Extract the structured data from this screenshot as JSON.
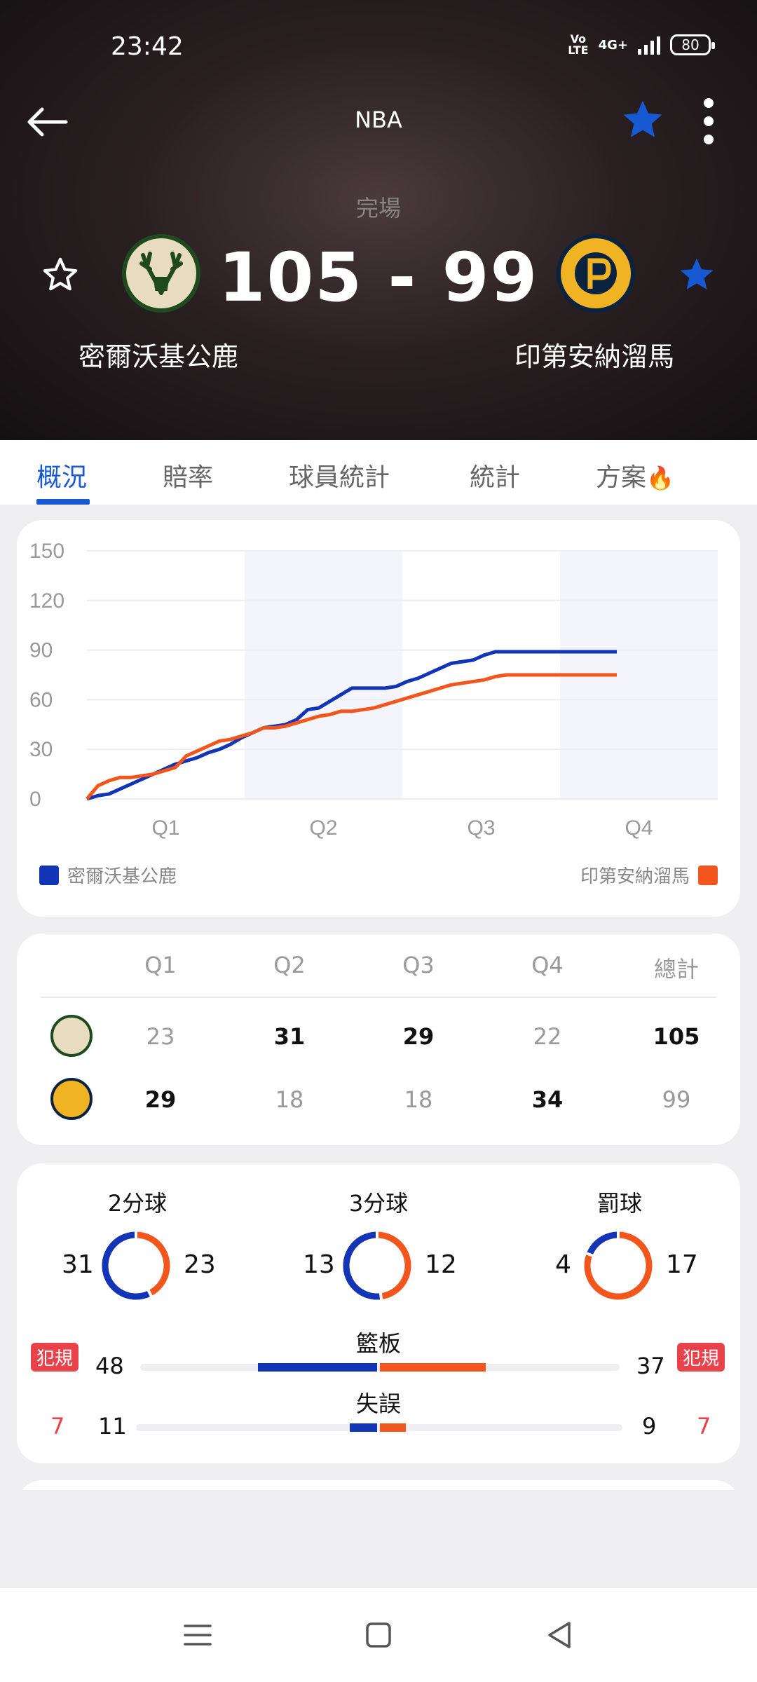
{
  "status_bar": {
    "time": "23:42",
    "volte": "Vo\nLTE",
    "network": "4G+",
    "battery": "80"
  },
  "header": {
    "title": "NBA",
    "status": "完場",
    "score": "105 - 99",
    "home": {
      "name": "密爾沃基公鹿",
      "logo": "bucks-logo"
    },
    "away": {
      "name": "印第安納溜馬",
      "logo": "pacers-logo"
    }
  },
  "colors": {
    "home": "#1235b8",
    "away": "#f2561d",
    "accent": "#1759d3",
    "foul": "#e8434a"
  },
  "tabs": [
    {
      "label": "概況",
      "active": true
    },
    {
      "label": "賠率"
    },
    {
      "label": "球員統計"
    },
    {
      "label": "統計"
    },
    {
      "label": "方案"
    }
  ],
  "chart_data": {
    "type": "line",
    "y_ticks": [
      "150",
      "120",
      "90",
      "60",
      "30",
      "0"
    ],
    "ylim": [
      0,
      150
    ],
    "x_ticks": [
      "Q1",
      "Q2",
      "Q3",
      "Q4"
    ],
    "xlim": [
      0,
      48
    ],
    "grid": true,
    "legend": "bottom",
    "series": [
      {
        "name": "密爾沃基公鹿",
        "color": "#1235b8",
        "x": [
          0,
          1,
          2,
          3,
          4,
          5,
          6,
          7,
          8,
          9,
          10,
          11,
          12,
          13,
          14,
          15,
          16,
          17,
          18,
          19,
          20,
          21,
          22,
          23,
          24,
          25,
          26,
          27,
          28,
          29,
          30,
          31,
          32,
          33,
          34,
          35,
          36,
          37,
          38,
          39,
          40,
          41,
          42,
          43,
          44,
          45,
          46,
          47,
          48
        ],
        "y": [
          0,
          2,
          3,
          6,
          9,
          12,
          15,
          18,
          21,
          23,
          25,
          28,
          30,
          33,
          37,
          40,
          43,
          44,
          45,
          48,
          54,
          55,
          59,
          63,
          67,
          67,
          67,
          67,
          68,
          71,
          73,
          76,
          79,
          82,
          83,
          84,
          87,
          89,
          89,
          89,
          89,
          89,
          89,
          89,
          89,
          89,
          89,
          89,
          89
        ]
      },
      {
        "name": "印第安納溜馬",
        "color": "#f2561d",
        "x": [
          0,
          1,
          2,
          3,
          4,
          5,
          6,
          7,
          8,
          9,
          10,
          11,
          12,
          13,
          14,
          15,
          16,
          17,
          18,
          19,
          20,
          21,
          22,
          23,
          24,
          25,
          26,
          27,
          28,
          29,
          30,
          31,
          32,
          33,
          34,
          35,
          36,
          37,
          38,
          39,
          40,
          41,
          42,
          43,
          44,
          45,
          46,
          47,
          48
        ],
        "y": [
          0,
          8,
          11,
          13,
          13,
          14,
          15,
          17,
          19,
          26,
          29,
          32,
          35,
          36,
          38,
          40,
          43,
          43,
          44,
          46,
          48,
          50,
          51,
          53,
          53,
          54,
          55,
          57,
          59,
          61,
          63,
          65,
          67,
          69,
          70,
          71,
          72,
          74,
          75,
          75,
          75,
          75,
          75,
          75,
          75,
          75,
          75,
          75,
          75
        ]
      }
    ]
  },
  "quarters": {
    "headers": [
      "Q1",
      "Q2",
      "Q3",
      "Q4",
      "總計"
    ],
    "home": [
      "23",
      "31",
      "29",
      "22",
      "105"
    ],
    "away": [
      "29",
      "18",
      "18",
      "34",
      "99"
    ]
  },
  "shots": [
    {
      "label": "2分球",
      "home": "31",
      "away": "23",
      "home_value": 31,
      "away_value": 23
    },
    {
      "label": "3分球",
      "home": "13",
      "away": "12",
      "home_value": 13,
      "away_value": 12
    },
    {
      "label": "罰球",
      "home": "4",
      "away": "17",
      "home_value": 4,
      "away_value": 17
    }
  ],
  "fouls": {
    "badge": "犯規",
    "home": "7",
    "away": "7"
  },
  "bars": [
    {
      "label": "籃板",
      "home": "48",
      "away": "37",
      "home_value": 48,
      "away_value": 37
    },
    {
      "label": "失誤",
      "home": "11",
      "away": "9",
      "home_value": 11,
      "away_value": 9
    }
  ]
}
